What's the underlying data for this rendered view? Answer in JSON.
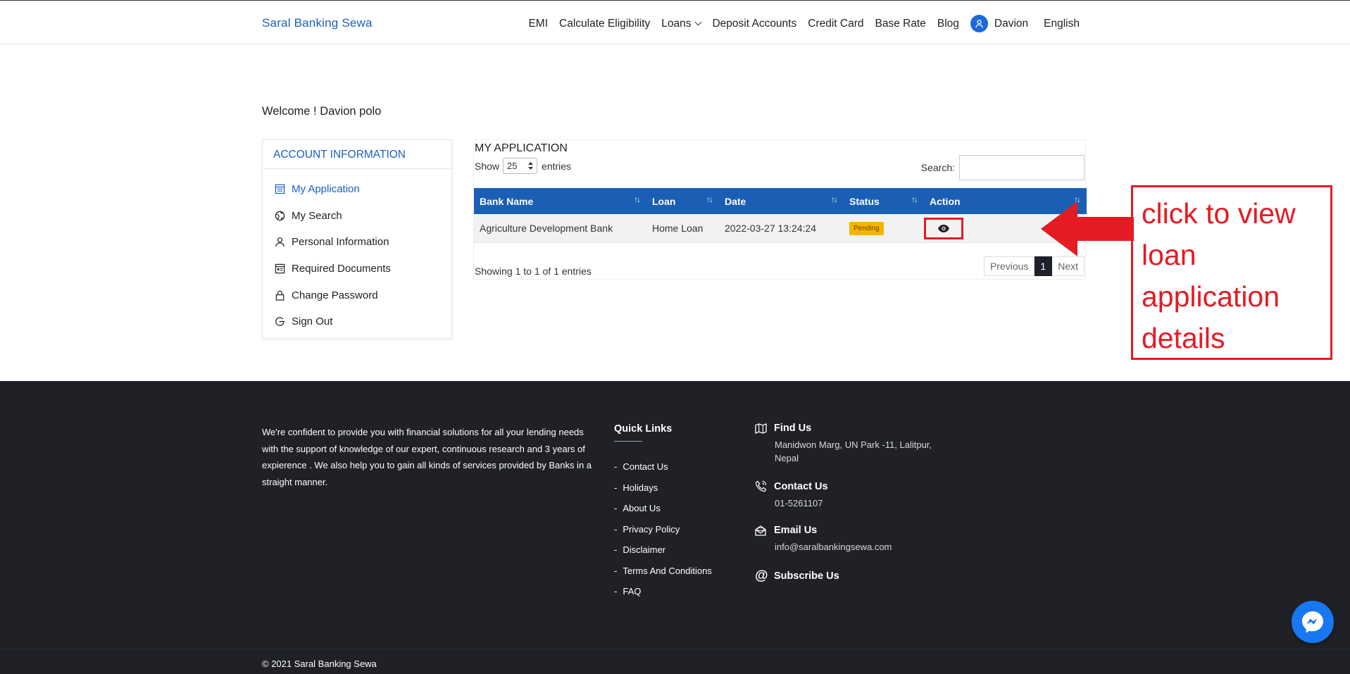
{
  "header": {
    "logo": "Saral Banking Sewa",
    "nav": [
      "EMI",
      "Calculate Eligibility",
      "Loans",
      "Deposit Accounts",
      "Credit Card",
      "Base Rate",
      "Blog"
    ],
    "user": "Davion",
    "language": "English"
  },
  "welcome": "Welcome ! Davion polo",
  "sidebar": {
    "title": "ACCOUNT INFORMATION",
    "items": [
      {
        "label": "My Application",
        "icon": "calendar-list-icon",
        "active": true
      },
      {
        "label": "My Search",
        "icon": "globe-icon"
      },
      {
        "label": "Personal Information",
        "icon": "user-icon"
      },
      {
        "label": "Required Documents",
        "icon": "document-icon"
      },
      {
        "label": "Change Password",
        "icon": "lock-icon"
      },
      {
        "label": "Sign Out",
        "icon": "sign-out-icon"
      }
    ]
  },
  "application": {
    "title": "MY APPLICATION",
    "show_label": "Show",
    "show_value": "25",
    "entries_label": "entries",
    "search_label": "Search:",
    "search_value": "",
    "columns": [
      "Bank Name",
      "Loan",
      "Date",
      "Status",
      "Action"
    ],
    "rows": [
      {
        "bank": "Agriculture Development Bank",
        "loan": "Home Loan",
        "date": "2022-03-27 13:24:24",
        "status": "Pending"
      }
    ],
    "showing": "Showing 1 to 1 of 1 entries",
    "pager": {
      "previous": "Previous",
      "current": "1",
      "next": "Next"
    }
  },
  "annotation": {
    "lines": [
      "click to view",
      "loan",
      "application",
      "details"
    ],
    "color": "#e41b23"
  },
  "footer": {
    "about": "We're confident to provide you with financial solutions for all your lending needs with the support of knowledge of our expert, continuous research and 3 years of expierence . We also help you to gain all kinds of services provided by Banks in a straight manner.",
    "quick_links_title": "Quick Links",
    "quick_links": [
      "Contact Us",
      "Holidays",
      "About Us",
      "Privacy Policy",
      "Disclaimer",
      "Terms And Conditions",
      "FAQ"
    ],
    "find_us_title": "Find Us",
    "find_us_text": "Manidwon Marg, UN Park -11, Lalitpur, Nepal",
    "contact_title": "Contact Us",
    "contact_text": "01-5261107",
    "email_title": "Email Us",
    "email_text": "info@saralbankingsewa.com",
    "subscribe_title": "Subscribe Us",
    "copyright": "© 2021 Saral Banking Sewa"
  },
  "colors": {
    "brand_blue": "#1a5fc0",
    "table_header": "#1a5fb4",
    "badge": "#f5b400",
    "footer_bg": "#1f2127",
    "messenger": "#1877f2"
  }
}
